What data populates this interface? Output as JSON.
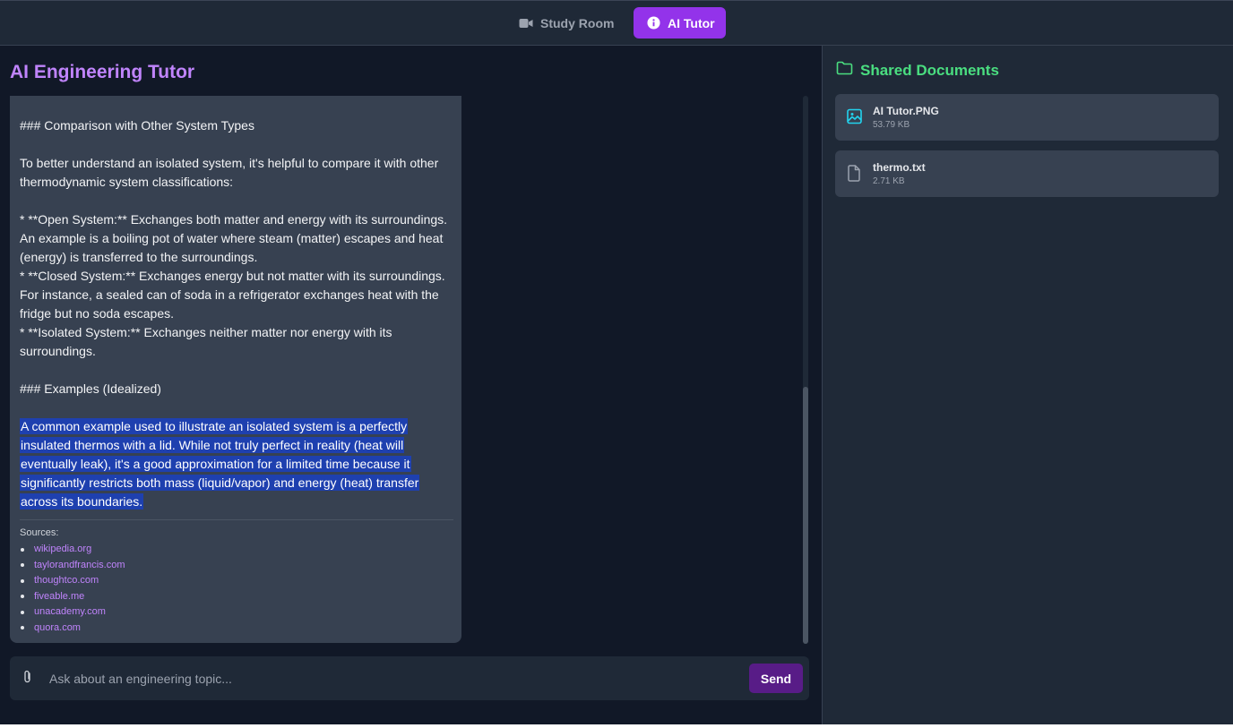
{
  "nav": {
    "tabs": [
      {
        "label": "Study Room",
        "icon": "video-icon",
        "active": false
      },
      {
        "label": "AI Tutor",
        "icon": "info-icon",
        "active": true
      }
    ]
  },
  "colors": {
    "accent": "#9333ea",
    "title": "#c084fc",
    "docs_heading": "#4ade80",
    "selection": "#1e40af"
  },
  "tutor": {
    "title": "AI Engineering Tutor",
    "message": {
      "paragraphs": [
        "### Comparison with Other System Types",
        "To better understand an isolated system, it's helpful to compare it with other thermodynamic system classifications:",
        "* **Open System:** Exchanges both matter and energy with its surroundings. An example is a boiling pot of water where steam (matter) escapes and heat (energy) is transferred to the surroundings.",
        "* **Closed System:** Exchanges energy but not matter with its surroundings. For instance, a sealed can of soda in a refrigerator exchanges heat with the fridge but no soda escapes.",
        "* **Isolated System:** Exchanges neither matter nor energy with its surroundings.",
        "### Examples (Idealized)",
        "A common example used to illustrate an isolated system is a perfectly insulated thermos with a lid. While not truly perfect in reality (heat will eventually leak), it's a good approximation for a limited time because it significantly restricts both mass (liquid/vapor) and energy (heat) transfer across its boundaries."
      ],
      "sources_label": "Sources:",
      "sources": [
        "wikipedia.org",
        "taylorandfrancis.com",
        "thoughtco.com",
        "fiveable.me",
        "unacademy.com",
        "quora.com"
      ]
    },
    "input": {
      "placeholder": "Ask about an engineering topic...",
      "value": "",
      "attach_icon": "paperclip-icon"
    },
    "send_label": "Send"
  },
  "documents": {
    "heading": "Shared Documents",
    "heading_icon": "folder-icon",
    "items": [
      {
        "name": "AI Tutor.PNG",
        "size": "53.79 KB",
        "icon": "image-file-icon"
      },
      {
        "name": "thermo.txt",
        "size": "2.71 KB",
        "icon": "text-file-icon"
      }
    ]
  }
}
